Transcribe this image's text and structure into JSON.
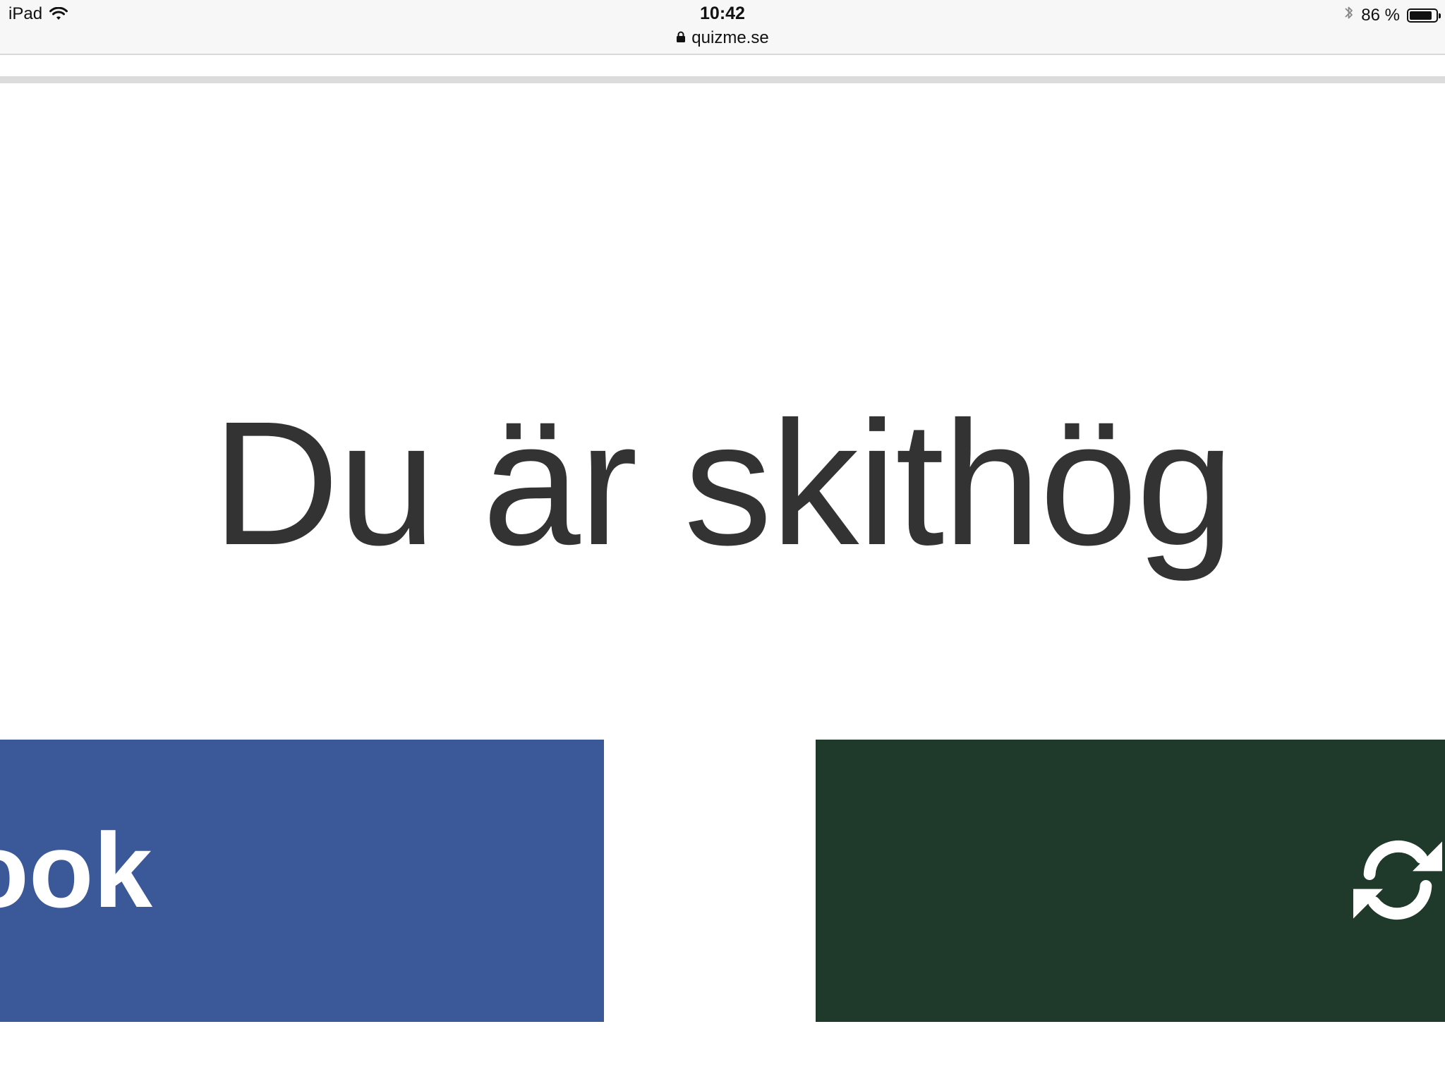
{
  "status_bar": {
    "device": "iPad",
    "time": "10:42",
    "url": "quizme.se",
    "battery_text": "86 %",
    "battery_level": 0.86,
    "icons": [
      "wifi-icon",
      "lock-icon",
      "bluetooth-icon",
      "battery-icon"
    ]
  },
  "result": {
    "text": "Du är skithög"
  },
  "buttons": {
    "facebook_label": "ook",
    "retry_icon": "refresh-icon"
  },
  "colors": {
    "facebook": "#3b5998",
    "retry": "#1f3a2a",
    "result_text": "#333333"
  }
}
